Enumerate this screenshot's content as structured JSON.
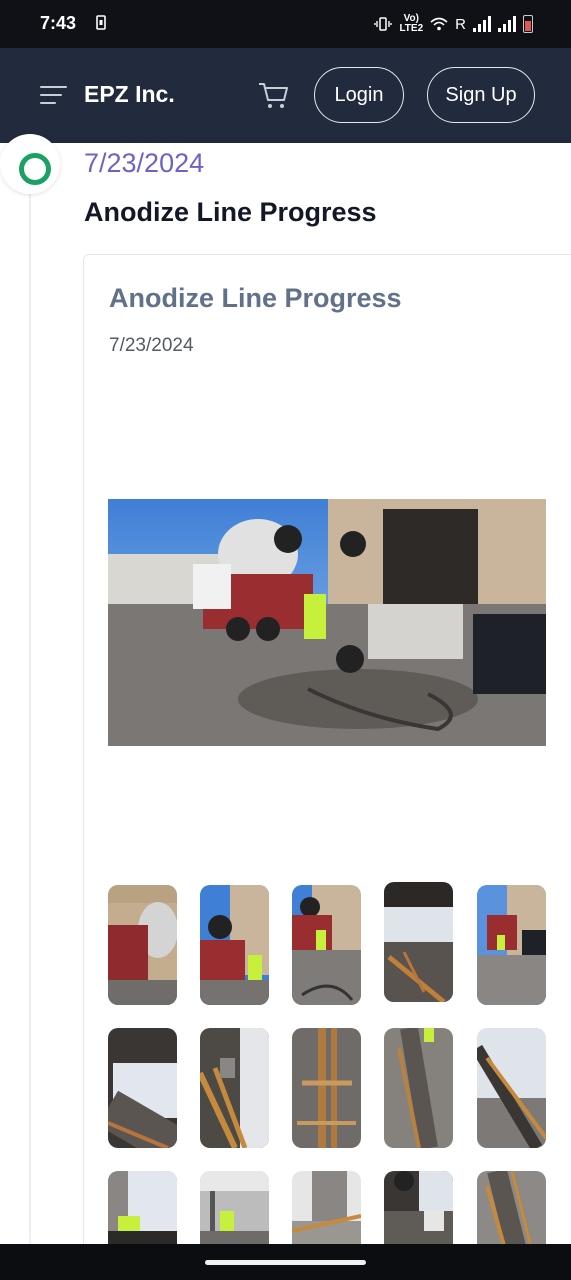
{
  "status_bar": {
    "time": "7:43",
    "carrier_top": "Vo)",
    "carrier_bottom": "LTE2",
    "roaming": "R"
  },
  "header": {
    "brand": "EPZ Inc.",
    "login_label": "Login",
    "signup_label": "Sign Up"
  },
  "timeline": {
    "entry_date": "7/23/2024",
    "entry_title": "Anodize Line Progress"
  },
  "card": {
    "title": "Anodize Line Progress",
    "date": "7/23/2024"
  },
  "icons": {
    "menu": "menu-icon",
    "cart": "cart-icon",
    "timeline_marker": "timeline-dot-icon"
  },
  "colors": {
    "header_bg": "#222b3d",
    "accent_purple": "#6c63c9",
    "timeline_green": "#1aa163",
    "card_title": "#617189"
  }
}
